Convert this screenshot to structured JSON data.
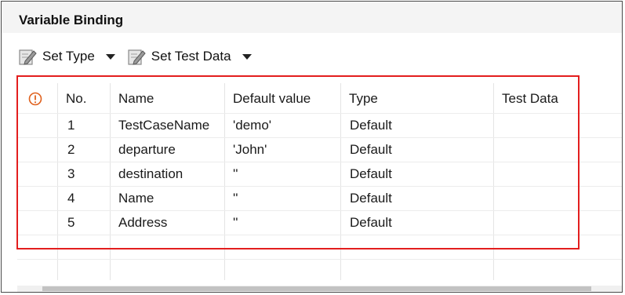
{
  "panel": {
    "title": "Variable Binding"
  },
  "toolbar": {
    "set_type_label": "Set Type",
    "set_test_data_label": "Set Test Data"
  },
  "table": {
    "headers": {
      "status": "",
      "no": "No.",
      "name": "Name",
      "default_value": "Default value",
      "type": "Type",
      "test_data": "Test Data"
    },
    "rows": [
      {
        "no": "1",
        "name": "TestCaseName",
        "default_value": "'demo'",
        "type": "Default",
        "test_data": ""
      },
      {
        "no": "2",
        "name": "departure",
        "default_value": "'John'",
        "type": "Default",
        "test_data": ""
      },
      {
        "no": "3",
        "name": "destination",
        "default_value": "''",
        "type": "Default",
        "test_data": ""
      },
      {
        "no": "4",
        "name": "Name",
        "default_value": "''",
        "type": "Default",
        "test_data": ""
      },
      {
        "no": "5",
        "name": "Address",
        "default_value": "''",
        "type": "Default",
        "test_data": ""
      }
    ]
  },
  "colors": {
    "highlight_box": "#e31e1e",
    "warning_icon": "#e0621f"
  },
  "icons": {
    "set_type": "edit-pencil-icon",
    "set_test_data": "edit-pencil-icon",
    "status_header": "warning-circle-icon"
  }
}
